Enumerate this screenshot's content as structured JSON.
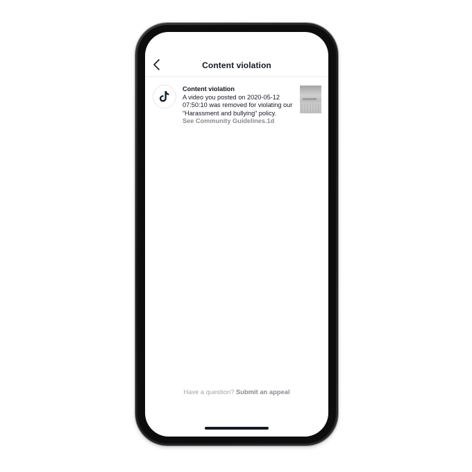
{
  "header": {
    "title": "Content violation",
    "back_icon": "chevron-left-icon"
  },
  "notification": {
    "avatar_icon": "tiktok-logo-icon",
    "title": "Content violation",
    "body": "A video you posted on 2020-05-12 07:50:10 was removed for violating our “Harassment and bullying” policy.",
    "link_label": "See Community Guidelines.",
    "time_ago": "1d"
  },
  "footer": {
    "question": "Have a question?",
    "appeal_label": "Submit an appeal"
  },
  "colors": {
    "text_primary": "#161823",
    "text_secondary": "#8a8b91",
    "background": "#ffffff"
  }
}
